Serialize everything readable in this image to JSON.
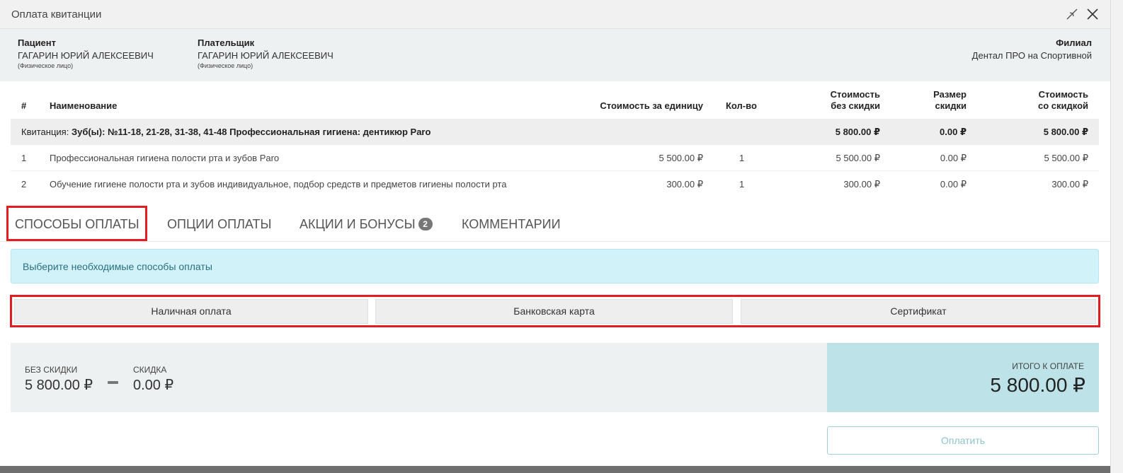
{
  "dialog": {
    "title": "Оплата квитанции"
  },
  "patient": {
    "label": "Пациент",
    "name": "ГАГАРИН ЮРИЙ АЛЕКСЕЕВИЧ",
    "type": "(Физическое лицо)"
  },
  "payer": {
    "label": "Плательщик",
    "name": "ГАГАРИН ЮРИЙ АЛЕКСЕЕВИЧ",
    "type": "(Физическое лицо)"
  },
  "branch": {
    "label": "Филиал",
    "name": "Дентал ПРО на Спортивной"
  },
  "table": {
    "headers": {
      "num": "#",
      "name": "Наименование",
      "unit_price": "Стоимость за единицу",
      "qty": "Кол-во",
      "no_discount_1": "Стоимость",
      "no_discount_2": "без скидки",
      "discount_1": "Размер",
      "discount_2": "скидки",
      "with_discount_1": "Стоимость",
      "with_discount_2": "со скидкой"
    },
    "summary": {
      "prefix": "Квитанция:",
      "title": "Зуб(ы): №11-18, 21-28, 31-38, 41-48 Профессиональная гигиена: дентикюр Paro",
      "no_discount": "5 800.00 ₽",
      "discount": "0.00 ₽",
      "with_discount": "5 800.00 ₽"
    },
    "rows": [
      {
        "num": "1",
        "name": "Профессиональная гигиена полости рта и зубов Paro",
        "unit_price": "5 500.00 ₽",
        "qty": "1",
        "no_discount": "5 500.00 ₽",
        "discount": "0.00 ₽",
        "with_discount": "5 500.00 ₽"
      },
      {
        "num": "2",
        "name": "Обучение гигиене полости рта и зубов индивидуальное, подбор средств и предметов гигиены полости рта",
        "unit_price": "300.00 ₽",
        "qty": "1",
        "no_discount": "300.00 ₽",
        "discount": "0.00 ₽",
        "with_discount": "300.00 ₽"
      }
    ]
  },
  "tabs": [
    {
      "label": "СПОСОБЫ ОПЛАТЫ",
      "active": true
    },
    {
      "label": "ОПЦИИ ОПЛАТЫ"
    },
    {
      "label": "АКЦИИ И БОНУСЫ",
      "badge": "2"
    },
    {
      "label": "КОММЕНТАРИИ"
    }
  ],
  "alert": {
    "text": "Выберите необходимые способы оплаты"
  },
  "payment_methods": [
    "Наличная оплата",
    "Банковская карта",
    "Сертификат"
  ],
  "totals": {
    "no_discount_label": "БЕЗ СКИДКИ",
    "no_discount_value": "5 800.00 ₽",
    "discount_label": "СКИДКА",
    "discount_value": "0.00 ₽",
    "grand_label": "ИТОГО К ОПЛАТЕ",
    "grand_value": "5 800.00 ₽"
  },
  "pay_button": "Оплатить",
  "colors": {
    "highlight": "#e31b23",
    "alert_bg": "#d1f2f9",
    "grand_bg": "#bde3e8"
  }
}
